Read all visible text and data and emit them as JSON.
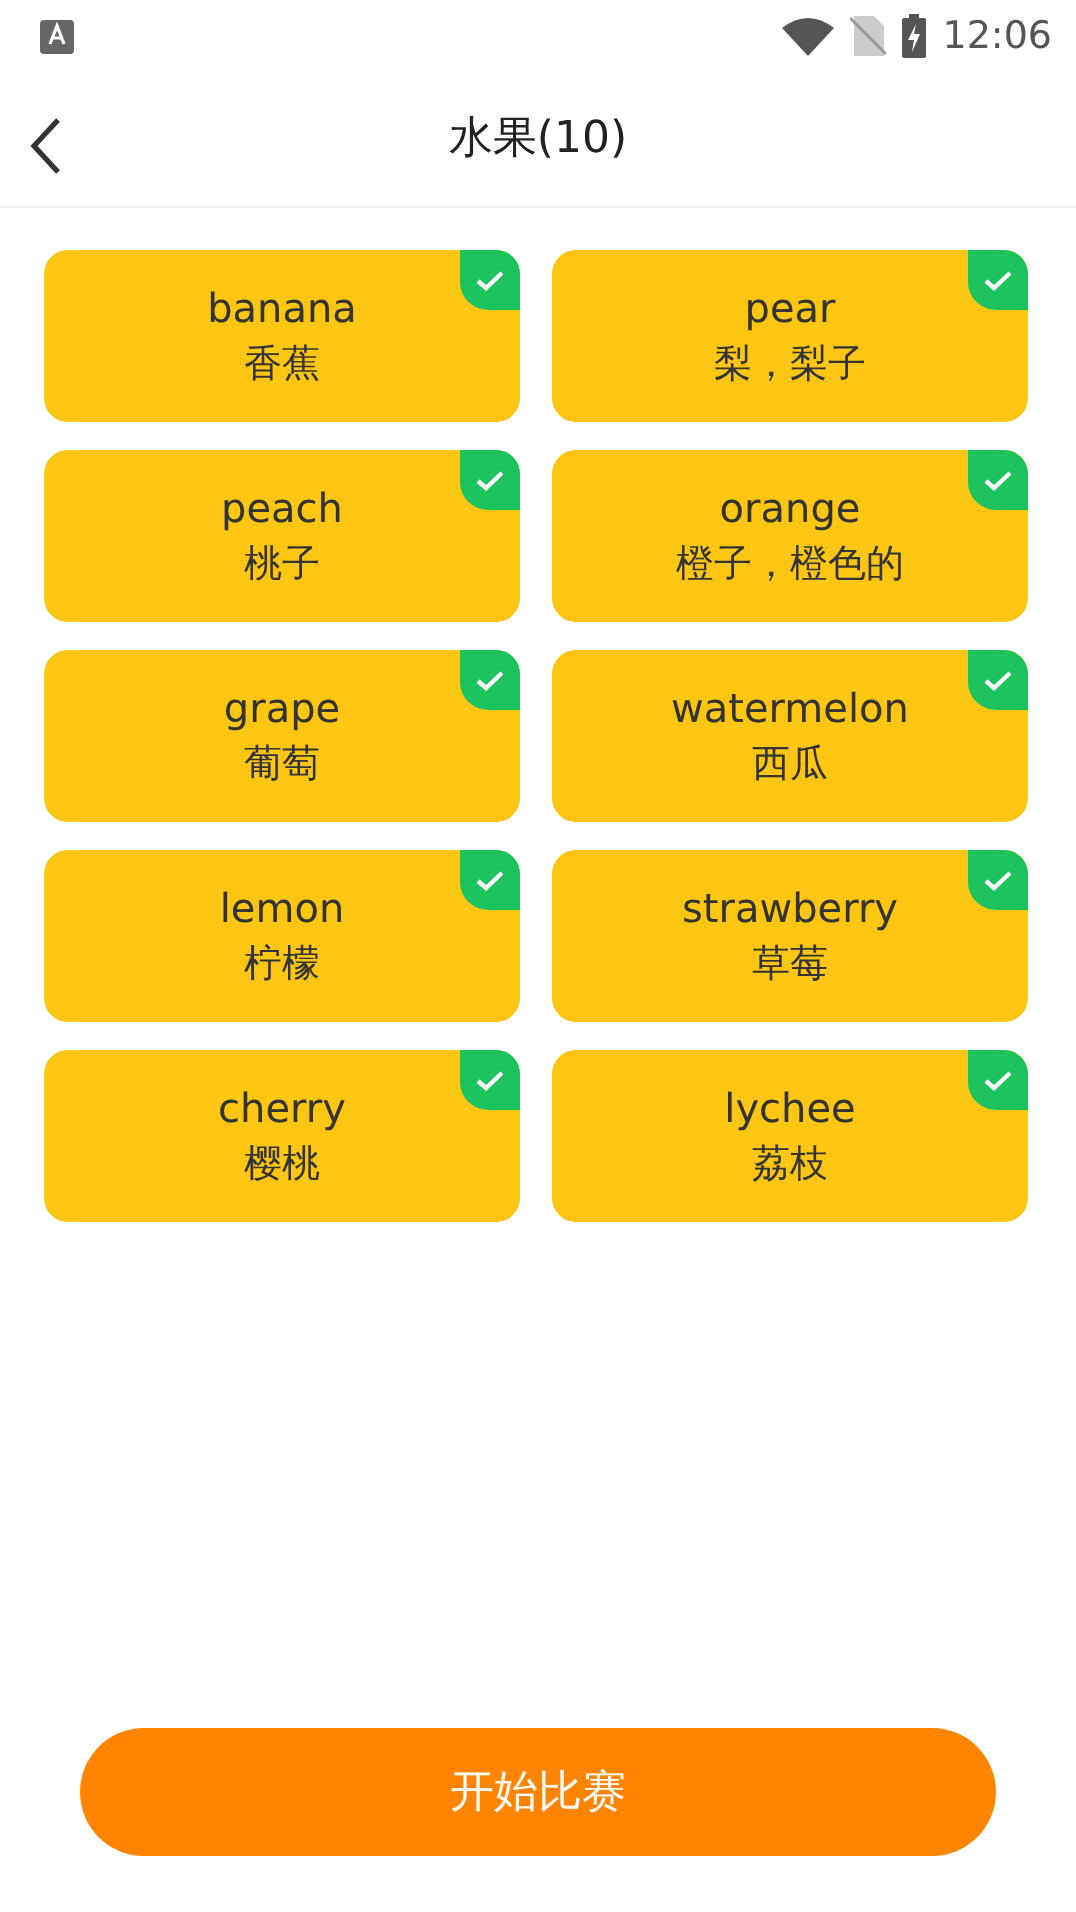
{
  "status_bar": {
    "time": "12:06"
  },
  "header": {
    "title": "水果(10)"
  },
  "words": [
    {
      "english": "banana",
      "chinese": "香蕉",
      "selected": true
    },
    {
      "english": "pear",
      "chinese": "梨，梨子",
      "selected": true
    },
    {
      "english": "peach",
      "chinese": "桃子",
      "selected": true
    },
    {
      "english": "orange",
      "chinese": "橙子，橙色的",
      "selected": true
    },
    {
      "english": "grape",
      "chinese": "葡萄",
      "selected": true
    },
    {
      "english": "watermelon",
      "chinese": "西瓜",
      "selected": true
    },
    {
      "english": "lemon",
      "chinese": "柠檬",
      "selected": true
    },
    {
      "english": "strawberry",
      "chinese": "草莓",
      "selected": true
    },
    {
      "english": "cherry",
      "chinese": "樱桃",
      "selected": true
    },
    {
      "english": "lychee",
      "chinese": "荔枝",
      "selected": true
    }
  ],
  "start_button": {
    "label": "开始比赛"
  }
}
